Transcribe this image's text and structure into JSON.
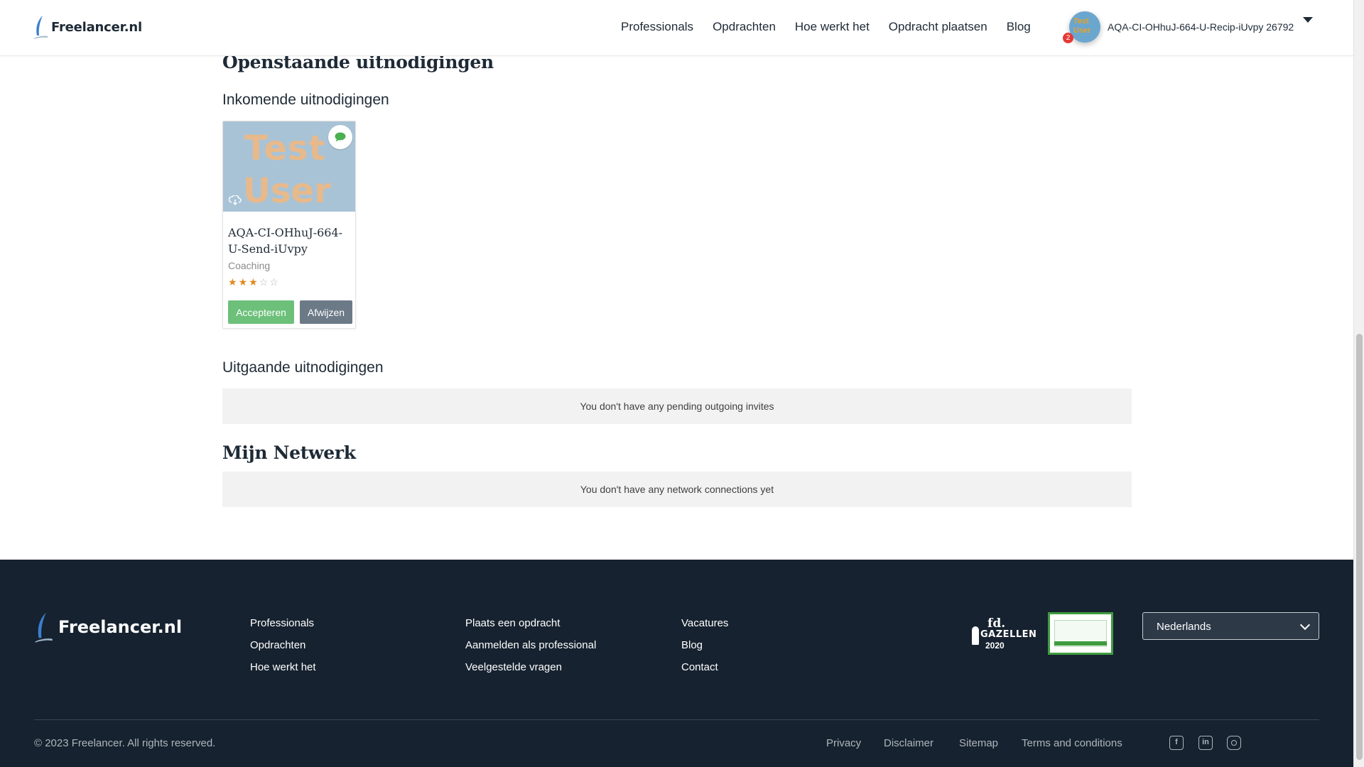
{
  "header": {
    "brand": "Freelancer.nl",
    "nav": [
      "Professionals",
      "Opdrachten",
      "Hoe werkt het",
      "Opdracht plaatsen",
      "Blog"
    ],
    "notification_count": "2",
    "username": "AQA-CI-OHhuJ-664-U-Recip-iUvpy 26792",
    "avatar_text": [
      "Test",
      "User"
    ]
  },
  "main": {
    "title_pending": "Openstaande uitnodigingen",
    "incoming_title": "Inkomende uitnodigingen",
    "incoming_card": {
      "photo_text_1": "Test",
      "photo_text_2": "User",
      "name": "AQA-CI-OHhuJ-664-U-Send-iUvpy",
      "category": "Coaching",
      "rating": 3,
      "rating_max": 5,
      "accept_label": "Accepteren",
      "reject_label": "Afwijzen"
    },
    "outgoing_title": "Uitgaande uitnodigingen",
    "outgoing_empty": "You don't have any pending outgoing invites",
    "network_title": "Mijn Netwerk",
    "network_empty": "You don't have any network connections yet"
  },
  "footer": {
    "brand": "Freelancer.nl",
    "col1": [
      "Professionals",
      "Opdrachten",
      "Hoe werkt het"
    ],
    "col2": [
      "Plaats een opdracht",
      "Aanmelden als professional",
      "Veelgestelde vragen"
    ],
    "col3": [
      "Vacatures",
      "Blog",
      "Contact"
    ],
    "badge_fd": {
      "line1": "fd.",
      "line2": "GAZELLEN",
      "line3": "2020"
    },
    "language": "Nederlands",
    "copyright": "© 2023 Freelancer. All rights reserved.",
    "legal": [
      "Privacy",
      "Disclaimer",
      "Sitemap",
      "Terms and conditions"
    ],
    "social": [
      "facebook-icon",
      "linkedin-icon",
      "instagram-icon"
    ]
  },
  "colors": {
    "accent_green": "#6cc07a",
    "muted_button": "#6c7987",
    "footer_bg": "#16222f",
    "star": "#e08a1e"
  }
}
